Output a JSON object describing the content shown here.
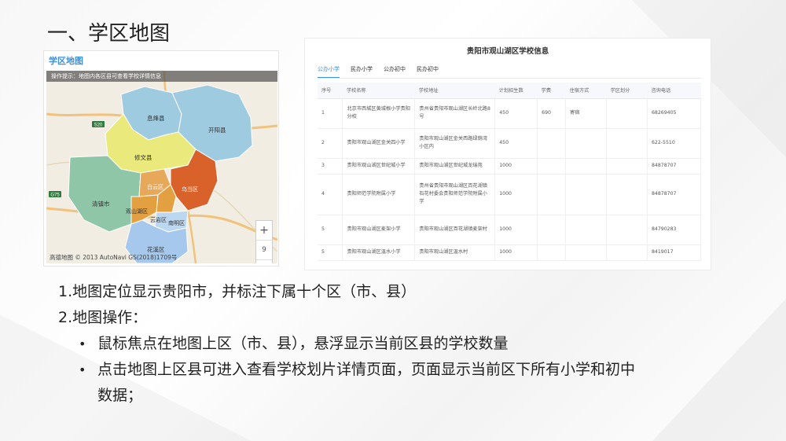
{
  "slide": {
    "title": "一、学区地图"
  },
  "map_panel": {
    "title": "学区地图",
    "hint": "操作提示：地图内各区县可查看学校详情信息",
    "zoom_in": "+",
    "zoom_level": "9",
    "zoom_out": "—",
    "footer": "高德地图 © 2013 AutoNavi  GS(2018)1709号",
    "districts": [
      {
        "name": "息烽县",
        "color": "#9fcbe0"
      },
      {
        "name": "开阳县",
        "color": "#9fcbe0"
      },
      {
        "name": "修文县",
        "color": "#eaea7c"
      },
      {
        "name": "白云区",
        "color": "#e8a85a"
      },
      {
        "name": "乌当区",
        "color": "#d9622b"
      },
      {
        "name": "清镇市",
        "color": "#8fc6a8"
      },
      {
        "name": "观山湖区",
        "color": "#e3a041"
      },
      {
        "name": "云岩区",
        "color": "#e3a041"
      },
      {
        "name": "南明区",
        "color": "#bcd7f0"
      },
      {
        "name": "花溪区",
        "color": "#a5c8ec"
      }
    ],
    "road_labels": [
      "S20",
      "G75"
    ]
  },
  "table_panel": {
    "title": "贵阳市观山湖区学校信息",
    "tabs": [
      "公办小学",
      "民办小学",
      "公办初中",
      "民办初中"
    ],
    "active_tab": "公办小学",
    "columns": [
      "序号",
      "学校名称",
      "学校地址",
      "计划招生数",
      "学费",
      "住宿方式",
      "学区划分",
      "咨询电话"
    ],
    "rows": [
      [
        "1",
        "北京市西城区黄城根小学贵阳分校",
        "贵州省贵阳市观山湖区长岭北路8号",
        "450",
        "690",
        "寄宿",
        "",
        "68269405"
      ],
      [
        "2",
        "贵阳市观山湖区金关四小学",
        "贵阳市观山湖区金关西路绿荫湾小区内",
        "450",
        "",
        "",
        "",
        "622-5510"
      ],
      [
        "3",
        "贵阳市观山湖区世纪城小学",
        "贵阳市观山湖区世纪城龙瑞苑",
        "1000",
        "",
        "",
        "",
        "84878707"
      ],
      [
        "4",
        "贵阳师范学院附属小学",
        "贵州省贵阳市观山湖区百花湖镇石花村委会贵阳师范学院附属小学",
        "1000",
        "",
        "",
        "",
        "84878707"
      ],
      [
        "5",
        "贵阳市观山湖区麦架小学",
        "贵阳市观山湖区百花湖镇麦架村",
        "1000",
        "",
        "",
        "",
        "84790283"
      ],
      [
        "5",
        "贵阳市观山湖区温水小学",
        "贵阳市观山湖区温水村",
        "1000",
        "",
        "",
        "",
        "8419017"
      ]
    ]
  },
  "description": {
    "item1": "1.地图定位显示贵阳市，并标注下属十个区（市、县）",
    "item2": "2.地图操作：",
    "bullet_symbol": "•",
    "bullet1": "鼠标焦点在地图上区（市、县），悬浮显示当前区县的学校数量",
    "bullet2": "点击地图上区县可进入查看学校划片详情页面，页面显示当前区下所有小学和初中",
    "bullet2_cont": "数据；"
  }
}
